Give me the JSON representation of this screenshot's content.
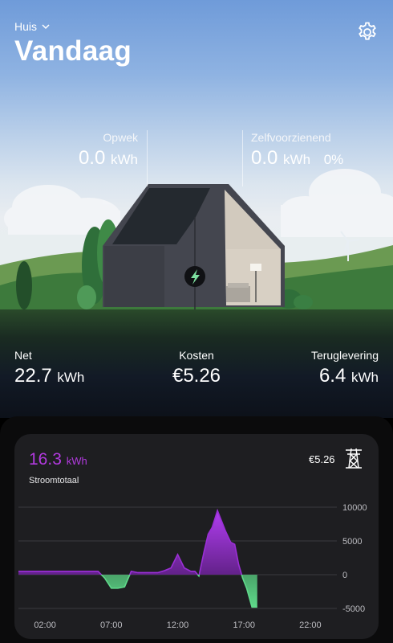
{
  "header": {
    "location": "Huis",
    "title": "Vandaag"
  },
  "stats_top": {
    "opwek": {
      "label": "Opwek",
      "value": "0.0",
      "unit": "kWh"
    },
    "zelfvoorzienend": {
      "label": "Zelfvoorzienend",
      "value": "0.0",
      "unit": "kWh",
      "percent": "0%"
    }
  },
  "stats_bottom": {
    "net": {
      "label": "Net",
      "value": "22.7",
      "unit": "kWh"
    },
    "kosten": {
      "label": "Kosten",
      "value": "€5.26"
    },
    "teruglevering": {
      "label": "Teruglevering",
      "value": "6.4",
      "unit": "kWh"
    }
  },
  "card": {
    "value": "16.3",
    "unit": "kWh",
    "subtitle": "Stroomtotaal",
    "cost": "€5.26"
  },
  "colors": {
    "purple": "#9a2fd6",
    "green": "#5fd98a"
  },
  "chart_data": {
    "type": "area",
    "x_ticks": [
      "02:00",
      "07:00",
      "12:00",
      "17:00",
      "22:00"
    ],
    "y_ticks": [
      "10000",
      "5000",
      "0",
      "-5000"
    ],
    "ylim": [
      -5000,
      10000
    ],
    "xlim": [
      0,
      24
    ],
    "grid": true,
    "x": [
      0,
      1,
      2,
      3,
      4,
      5,
      6,
      6.5,
      7,
      7.5,
      8,
      8.5,
      9,
      9.5,
      10,
      10.5,
      11,
      11.5,
      12,
      12.5,
      13,
      13.3,
      13.6,
      14,
      14.3,
      14.6,
      15,
      15.3,
      15.6,
      16,
      16.3,
      16.6,
      16.9,
      17.2,
      17.6,
      18
    ],
    "y": [
      500,
      500,
      500,
      500,
      500,
      500,
      500,
      -500,
      -2000,
      -2000,
      -1800,
      500,
      300,
      300,
      300,
      300,
      600,
      1000,
      3000,
      1000,
      500,
      500,
      -200,
      3500,
      6000,
      7000,
      9500,
      8000,
      6500,
      4800,
      4500,
      1500,
      -500,
      -2000,
      -4800,
      -4800
    ]
  }
}
